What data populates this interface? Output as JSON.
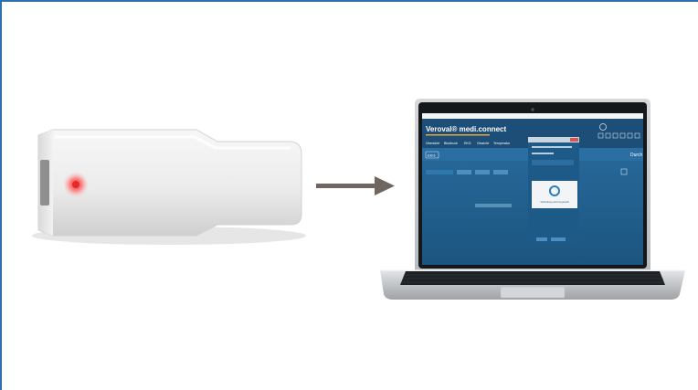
{
  "colors": {
    "frame_border": "#2f6fb0",
    "app_blue": "#1f5c8c",
    "app_header": "#173f66",
    "arrow": "#6f6660",
    "led": "#e32a2a"
  },
  "icons": {
    "usb_stick": "usb-dongle-illustration",
    "arrow": "right-arrow",
    "laptop": "laptop-illustration"
  },
  "screen": {
    "brand": "Veroval® medi.connect",
    "nav": [
      "Übersicht",
      "Blutdruck",
      "EKG",
      "Gewicht",
      "Temperatur"
    ],
    "section_label": "EKG",
    "dialog_message": "Verbindung wird hergestellt",
    "partial_right_text": "Durch"
  }
}
